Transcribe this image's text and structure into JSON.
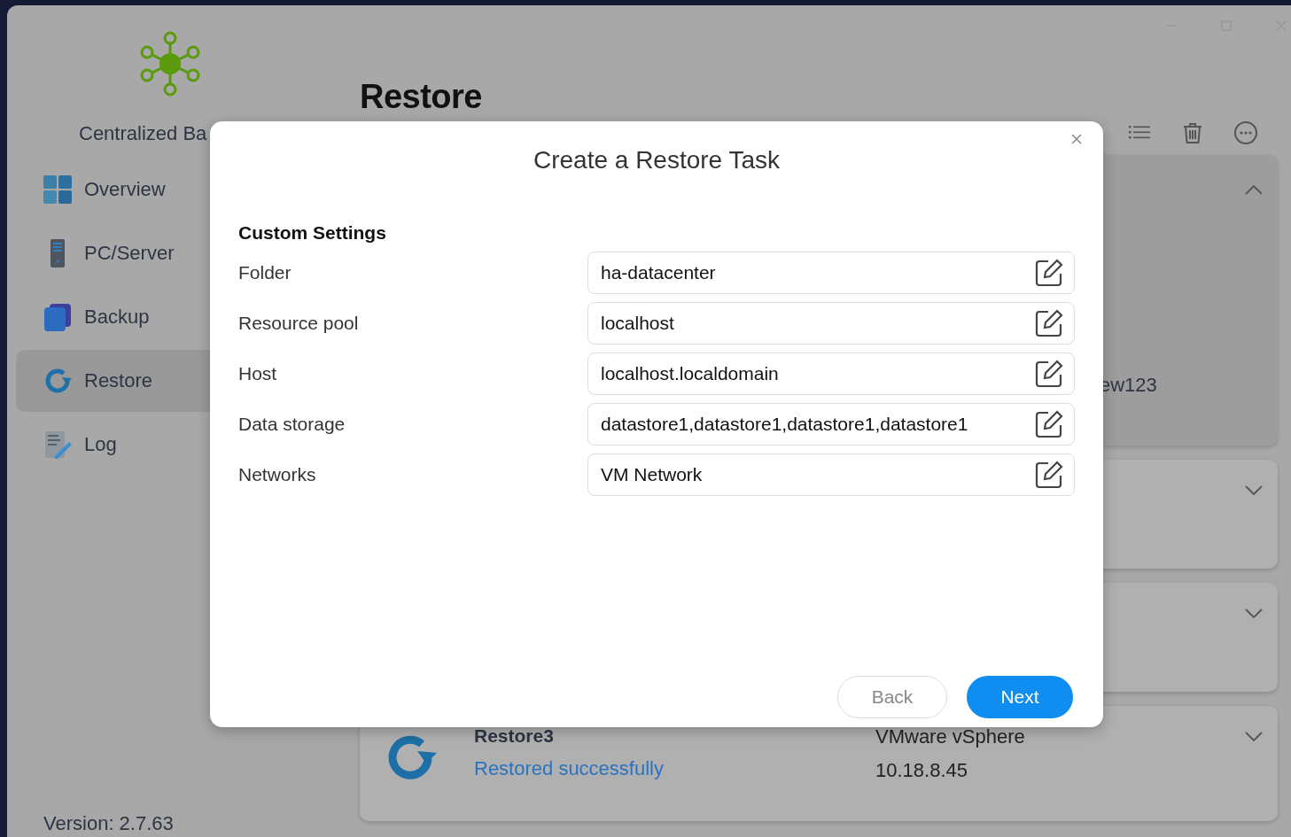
{
  "window": {
    "controls": [
      {
        "kind": "minimize"
      },
      {
        "kind": "maximize"
      },
      {
        "kind": "close"
      }
    ]
  },
  "sidebar": {
    "app_name": "Centralized Ba",
    "items": [
      {
        "label": "Overview",
        "kind": "overview",
        "selected": false
      },
      {
        "label": "PC/Server",
        "kind": "server",
        "selected": false
      },
      {
        "label": "Backup",
        "kind": "backup",
        "selected": false
      },
      {
        "label": "Restore",
        "kind": "restore",
        "selected": true
      },
      {
        "label": "Log",
        "kind": "log",
        "selected": false
      }
    ],
    "version": "Version: 2.7.63"
  },
  "main": {
    "title": "Restore",
    "toolbar": [
      {
        "kind": "list"
      },
      {
        "kind": "delete"
      },
      {
        "kind": "more"
      }
    ],
    "cards": [
      {
        "expanded": true,
        "column_3": "ew123"
      },
      {
        "expanded": false
      },
      {
        "expanded": false
      },
      {
        "expanded": false,
        "name": "Restore3",
        "status": "Restored successfully",
        "type": "VMware vSphere",
        "address": "10.18.8.45"
      }
    ]
  },
  "dialog": {
    "title": "Create a Restore Task",
    "section": "Custom Settings",
    "fields": [
      {
        "label": "Folder",
        "value": "ha-datacenter"
      },
      {
        "label": "Resource pool",
        "value": "localhost"
      },
      {
        "label": "Host",
        "value": "localhost.localdomain"
      },
      {
        "label": "Data storage",
        "value": "datastore1,datastore1,datastore1,datastore1"
      },
      {
        "label": "Networks",
        "value": "VM Network"
      }
    ],
    "buttons": [
      {
        "label": "Back",
        "kind": "secondary"
      },
      {
        "label": "Next",
        "kind": "primary"
      }
    ]
  }
}
